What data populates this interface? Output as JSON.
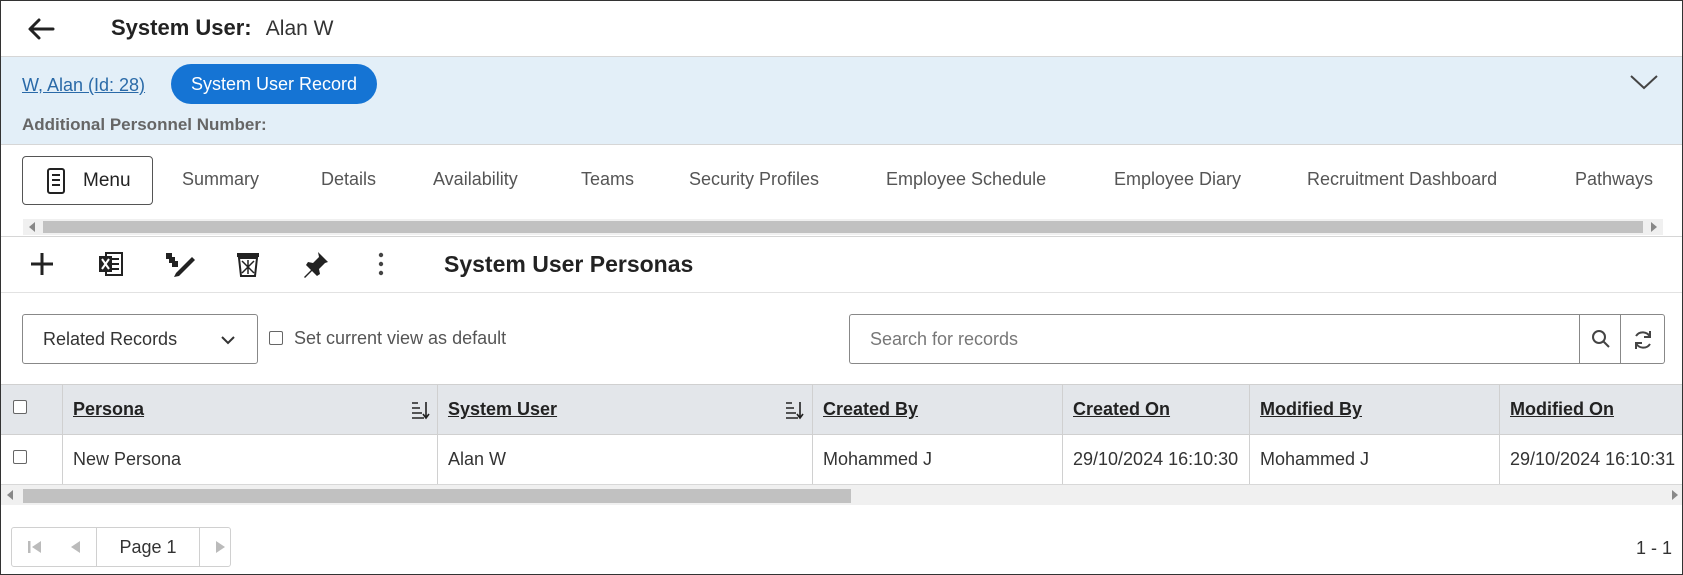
{
  "header": {
    "title_label": "System User:",
    "title_value": "Alan W"
  },
  "record": {
    "link": "W, Alan (Id: 28)",
    "pill": "System User Record",
    "extra_label": "Additional Personnel Number:"
  },
  "tabs": {
    "menu_label": "Menu",
    "items": [
      "Summary",
      "Details",
      "Availability",
      "Teams",
      "Security Profiles",
      "Employee Schedule",
      "Employee Diary",
      "Recruitment Dashboard",
      "Pathways"
    ]
  },
  "toolbar": {
    "title": "System User Personas",
    "icons": [
      "add-icon",
      "excel-export-icon",
      "bulk-edit-icon",
      "delete-icon",
      "pin-icon",
      "more-options-icon"
    ]
  },
  "filter": {
    "view_label": "Related Records",
    "default_label": "Set current view as default",
    "search_placeholder": "Search for records"
  },
  "grid": {
    "columns": [
      "Persona",
      "System User",
      "Created By",
      "Created On",
      "Modified By",
      "Modified On"
    ],
    "rows": [
      [
        "New Persona",
        "Alan W",
        "Mohammed J",
        "29/10/2024 16:10:30",
        "Mohammed J",
        "29/10/2024 16:10:31"
      ]
    ]
  },
  "pager": {
    "page_label": "Page 1",
    "count": "1 - 1"
  },
  "colors": {
    "accent": "#1574d4",
    "band": "#e3eff8",
    "grid_header": "#e3e6ea"
  }
}
